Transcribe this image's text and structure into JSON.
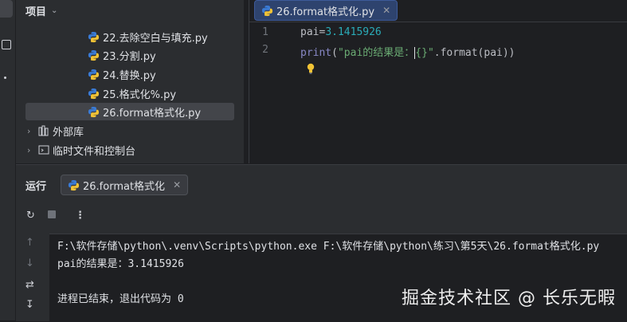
{
  "project": {
    "title": "项目",
    "files": [
      {
        "name": "22.去除空白与填充.py",
        "selected": false
      },
      {
        "name": "23.分割.py",
        "selected": false
      },
      {
        "name": "24.替换.py",
        "selected": false
      },
      {
        "name": "25.格式化%.py",
        "selected": false
      },
      {
        "name": "26.format格式化.py",
        "selected": true
      }
    ],
    "external_libs": "外部库",
    "scratches": "临时文件和控制台"
  },
  "editor": {
    "tab_label": "26.format格式化.py",
    "line_numbers": [
      "1",
      "2"
    ],
    "line1": {
      "var": "pai",
      "op": "=",
      "value": "3.1415926"
    },
    "line2": {
      "fn": "print",
      "open": "(",
      "string": "\"pai的结果是：",
      "caret_part": "{}",
      "string_end": "\"",
      "rest": ".format(pai))"
    }
  },
  "run": {
    "title": "运行",
    "tab_label": "26.format格式化",
    "console": [
      "F:\\软件存储\\python\\.venv\\Scripts\\python.exe F:\\软件存储\\python\\练习\\第5天\\26.format格式化.py",
      "pai的结果是：3.1415926",
      "",
      "进程已结束，退出代码为 0"
    ]
  },
  "watermark": "掘金技术社区 @ 长乐无暇",
  "colors": {
    "background": "#1e1f22",
    "panel": "#2b2d30",
    "selection": "#43454a",
    "tab_active": "#2e436e",
    "number": "#2aacb8",
    "string": "#6aab73",
    "builtin": "#8888c6"
  }
}
